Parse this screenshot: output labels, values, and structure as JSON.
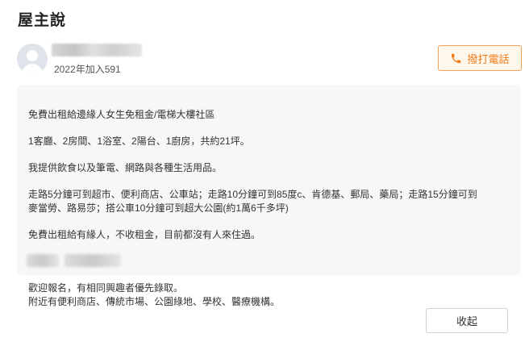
{
  "section": {
    "title": "屋主說"
  },
  "owner": {
    "joined": "2022年加入591"
  },
  "call_button": {
    "label": "撥打電話",
    "icon": "phone-icon",
    "color": "#ef7a1a"
  },
  "description": {
    "paragraphs": [
      "免費出租給邊緣人女生免租金/電梯大樓社區",
      "1客廳、2房間、1浴室、2陽台、1廚房，共約21坪。",
      "我提供飲食以及筆電、網路與各種生活用品。",
      "走路5分鐘可到超市、便利商店、公車站；走路10分鐘可到85度c、肯德基、郵局、藥局；走路15分鐘可到",
      "麥當勞、路易莎；搭公車10分鐘可到超大公園(約1萬6千多坪)",
      "免費出租給有緣人，不收租金，目前都沒有人來住過。"
    ]
  },
  "footer_text": {
    "lines": [
      "歡迎報名，有相同興趣者優先錄取。",
      "附近有便利商店、傳統市場、公園綠地、學校、醫療機構。"
    ]
  },
  "collapse_button": {
    "label": "收起"
  }
}
